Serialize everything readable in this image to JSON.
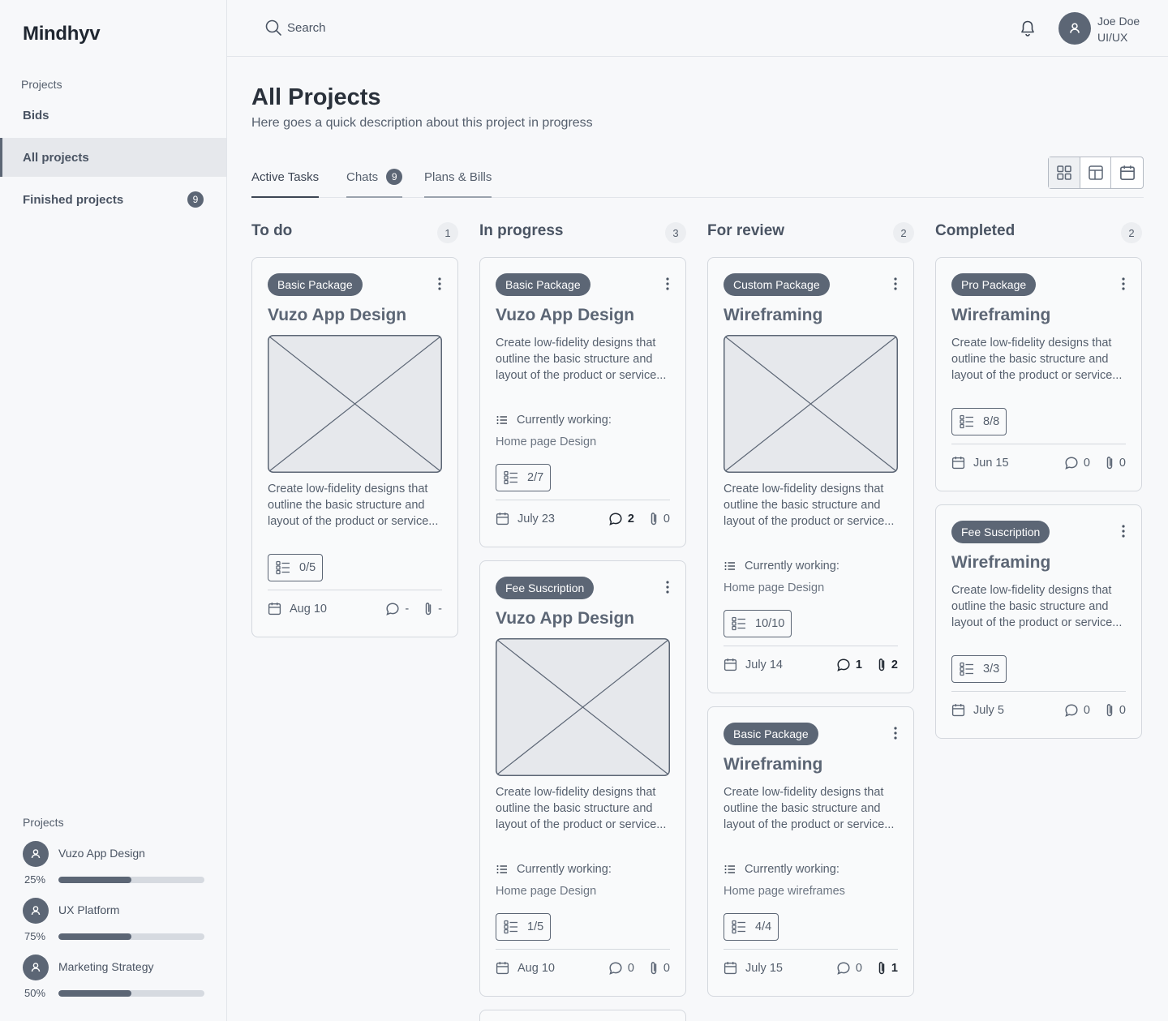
{
  "app": {
    "logo": "Mindhyv"
  },
  "sidebar": {
    "section_label": "Projects",
    "items": [
      {
        "label": "Bids"
      },
      {
        "label": "All projects",
        "active": true
      },
      {
        "label": "Finished projects",
        "badge": "9"
      }
    ],
    "projects_label": "Projects",
    "projects": [
      {
        "name": "Vuzo App Design",
        "progress_text": "25%"
      },
      {
        "name": "UX Platform",
        "progress_text": "75%"
      },
      {
        "name": "Marketing Strategy",
        "progress_text": "50%"
      }
    ]
  },
  "topbar": {
    "search_label": "Search",
    "user_name": "Joe Doe",
    "user_role": "UI/UX"
  },
  "page": {
    "title": "All Projects",
    "description": "Here goes a quick description about this project in progress",
    "tabs": [
      {
        "label": "Active Tasks"
      },
      {
        "label": "Chats",
        "badge": "9"
      },
      {
        "label": "Plans & Bills"
      }
    ]
  },
  "board": {
    "columns": [
      {
        "title": "To do",
        "count": "1",
        "cards": [
          {
            "package": "Basic Package",
            "title": "Vuzo App Design",
            "description": "Create low-fidelity designs that outline the basic structure and layout of the product or service...",
            "checklist": "0/5",
            "date": "Aug 10",
            "comments": "-",
            "attachments": "-"
          }
        ]
      },
      {
        "title": "In progress",
        "count": "3",
        "cards": [
          {
            "package": "Basic Package",
            "title": "Vuzo App Design",
            "description": "Create low-fidelity designs that outline the basic structure and layout of the product or service...",
            "currently_label": "Currently working:",
            "currently": "Home page Design",
            "checklist": "2/7",
            "date": "July 23",
            "comments": "2",
            "attachments": "0"
          },
          {
            "package": "Fee Suscription",
            "title": "Vuzo App Design",
            "description": "Create low-fidelity designs that outline the basic structure and layout of the product or service...",
            "currently_label": "Currently working:",
            "currently": "Home page Design",
            "checklist": "1/5",
            "date": "Aug 10",
            "comments": "0",
            "attachments": "0"
          }
        ]
      },
      {
        "title": "For review",
        "count": "2",
        "cards": [
          {
            "package": "Custom Package",
            "title": "Wireframing",
            "description": "Create low-fidelity designs that outline the basic structure and layout of the product or service...",
            "currently_label": "Currently working:",
            "currently": "Home page Design",
            "checklist": "10/10",
            "date": "July 14",
            "comments": "1",
            "attachments": "2"
          },
          {
            "package": "Basic Package",
            "title": "Wireframing",
            "description": "Create low-fidelity designs that outline the basic structure and layout of the product or service...",
            "currently_label": "Currently working:",
            "currently": "Home page wireframes",
            "checklist": "4/4",
            "date": "July 15",
            "comments": "0",
            "attachments": "1"
          }
        ]
      },
      {
        "title": "Completed",
        "count": "2",
        "cards": [
          {
            "package": "Pro Package",
            "title": "Wireframing",
            "description": "Create low-fidelity designs that outline the basic structure and layout of the product or service...",
            "checklist": "8/8",
            "date": "Jun 15",
            "comments": "0",
            "attachments": "0"
          },
          {
            "package": "Fee Suscription",
            "title": "Wireframing",
            "description": "Create low-fidelity designs that outline the basic structure and layout of the product or service...",
            "checklist": "3/3",
            "date": "July 5",
            "comments": "0",
            "attachments": "0"
          }
        ]
      }
    ]
  },
  "colors": {
    "accent": "#5c6675",
    "border": "#d4d8de",
    "text": "#3d4654"
  }
}
